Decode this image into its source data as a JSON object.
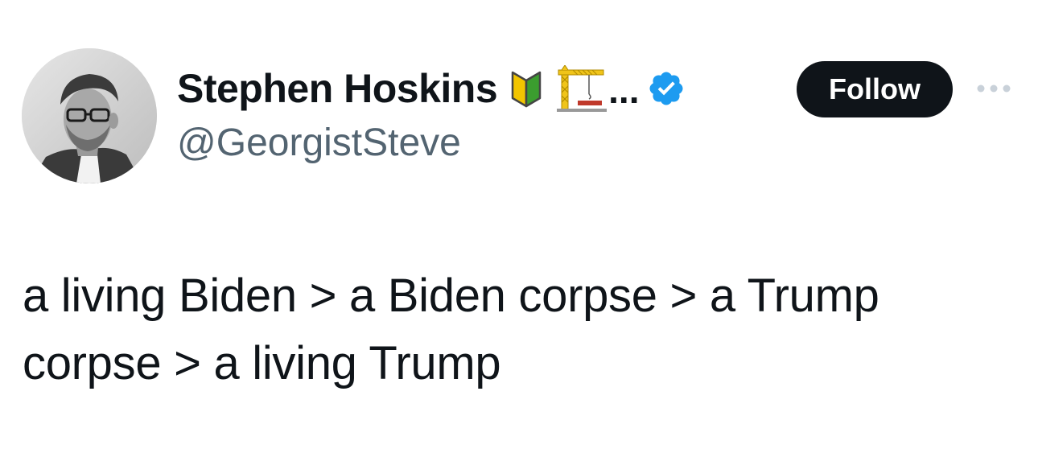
{
  "author": {
    "display_name": "Stephen Hoskins",
    "name_emoji": [
      "beginner-symbol",
      "building-construction-crane"
    ],
    "name_truncation": "...",
    "handle": "@GeorgistSteve",
    "verified": true
  },
  "actions": {
    "follow_label": "Follow"
  },
  "tweet": {
    "text": "a living Biden > a Biden corpse > a Trump corpse > a living Trump"
  },
  "colors": {
    "text_primary": "#0f1419",
    "text_secondary": "#536471",
    "verified_blue": "#1d9bf0",
    "follow_bg": "#0f1419",
    "follow_text": "#ffffff"
  }
}
